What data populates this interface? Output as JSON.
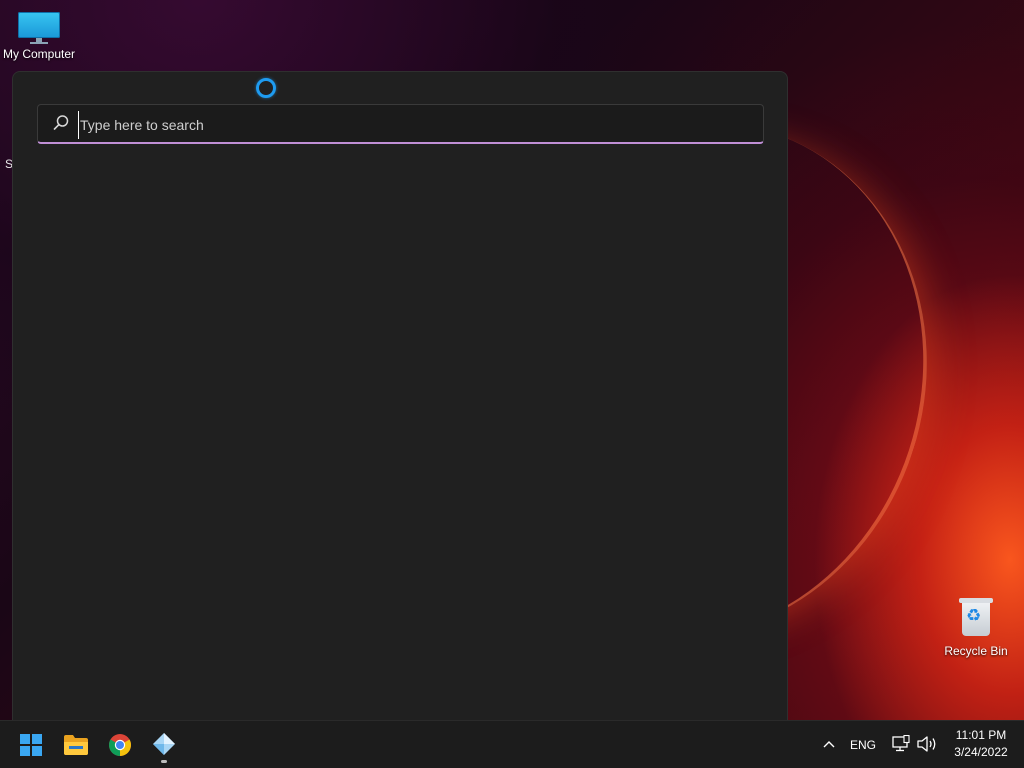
{
  "desktop": {
    "icons": [
      {
        "label": "My Computer",
        "icon": "monitor-icon"
      },
      {
        "label": "Recycle Bin",
        "icon": "recycle-bin-icon"
      }
    ],
    "partial_label": "S"
  },
  "search_panel": {
    "search_placeholder": "Type here to search",
    "search_value": "",
    "accent_color": "#c08fd6",
    "cortana_color": "#1e9bf0"
  },
  "taskbar": {
    "pinned": [
      {
        "name": "Start",
        "icon": "windows-logo-icon"
      },
      {
        "name": "File Explorer",
        "icon": "folder-icon"
      },
      {
        "name": "Google Chrome",
        "icon": "chrome-icon"
      },
      {
        "name": "App",
        "icon": "diamond-app-icon",
        "running": true
      }
    ],
    "tray": {
      "show_hidden_icon": "chevron-up-icon",
      "language": "ENG",
      "network_icon": "network-icon",
      "volume_icon": "speaker-icon"
    },
    "clock": {
      "time": "11:01 PM",
      "date": "3/24/2022"
    }
  }
}
